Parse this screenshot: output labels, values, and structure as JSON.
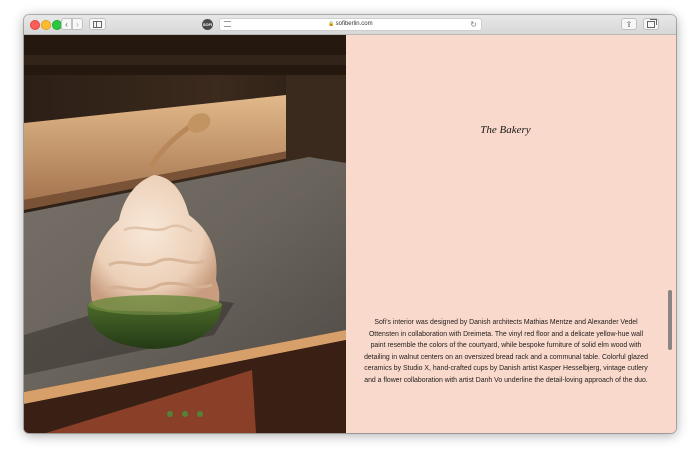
{
  "browser": {
    "url": "sofiberlin.com",
    "site_icon_label": "SOFI",
    "back_icon": "‹",
    "forward_icon": "›",
    "reload_icon": "↻",
    "share_icon": "⇪",
    "lock_icon": "🔒"
  },
  "page": {
    "heading": "The Bakery",
    "description": "Sofi's interior was designed by Danish architects Mathias Mentze and Alexander Vedel Ottensten in collaboration with Dreimeta. The vinyl red floor and a delicate yellow-hue wall paint resemble the colors of the courtyard, while bespoke furniture of solid elm wood with detailing in walnut centers on an oversized bread rack and a communal table. Colorful glazed ceramics by Studio X, hand-crafted cups by Danish artist Kasper Hesselbjerg, vintage cutlery and a flower collaboration with artist Danh Vo underline the detail-loving approach of the duo.",
    "carousel": {
      "slide_count": 3,
      "active_index": 0
    }
  },
  "colors": {
    "page_background": "#f9d9cb",
    "carousel_dot": "#4e8a3a"
  }
}
